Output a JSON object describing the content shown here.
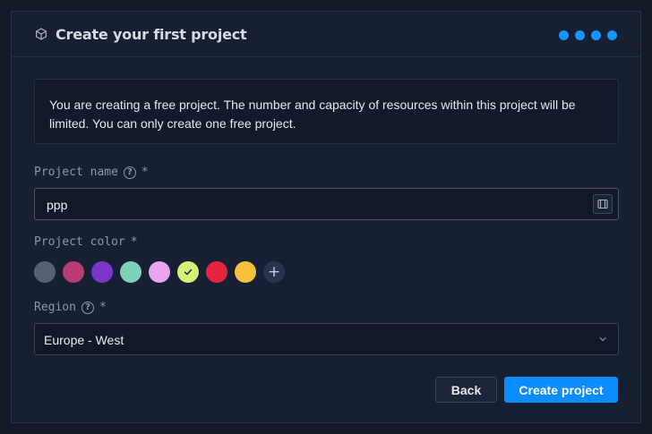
{
  "dialog": {
    "title": "Create your first project",
    "title_icon": "cube-icon",
    "steps": 4,
    "step_color": "#1694ff"
  },
  "notice": {
    "text": "You are creating a free project. The number and capacity of resources within this project will be limited. You can only create one free project."
  },
  "project_name": {
    "label": "Project name",
    "required_mark": "*",
    "help_icon": "question-circle-icon",
    "value": "ppp",
    "trailing_icon": "id-card-icon"
  },
  "project_color": {
    "label": "Project color",
    "required_mark": "*",
    "colors": [
      "#576175",
      "#b93c73",
      "#7b35c9",
      "#7fd1b8",
      "#e7a4ef",
      "#d6f07a",
      "#e3253d",
      "#f4c03e"
    ],
    "selected_index": 5,
    "add_label": "+"
  },
  "region": {
    "label": "Region",
    "required_mark": "*",
    "help_icon": "question-circle-icon",
    "value": "Europe - West"
  },
  "actions": {
    "back_label": "Back",
    "create_label": "Create project",
    "accent": "#0d8cff"
  }
}
